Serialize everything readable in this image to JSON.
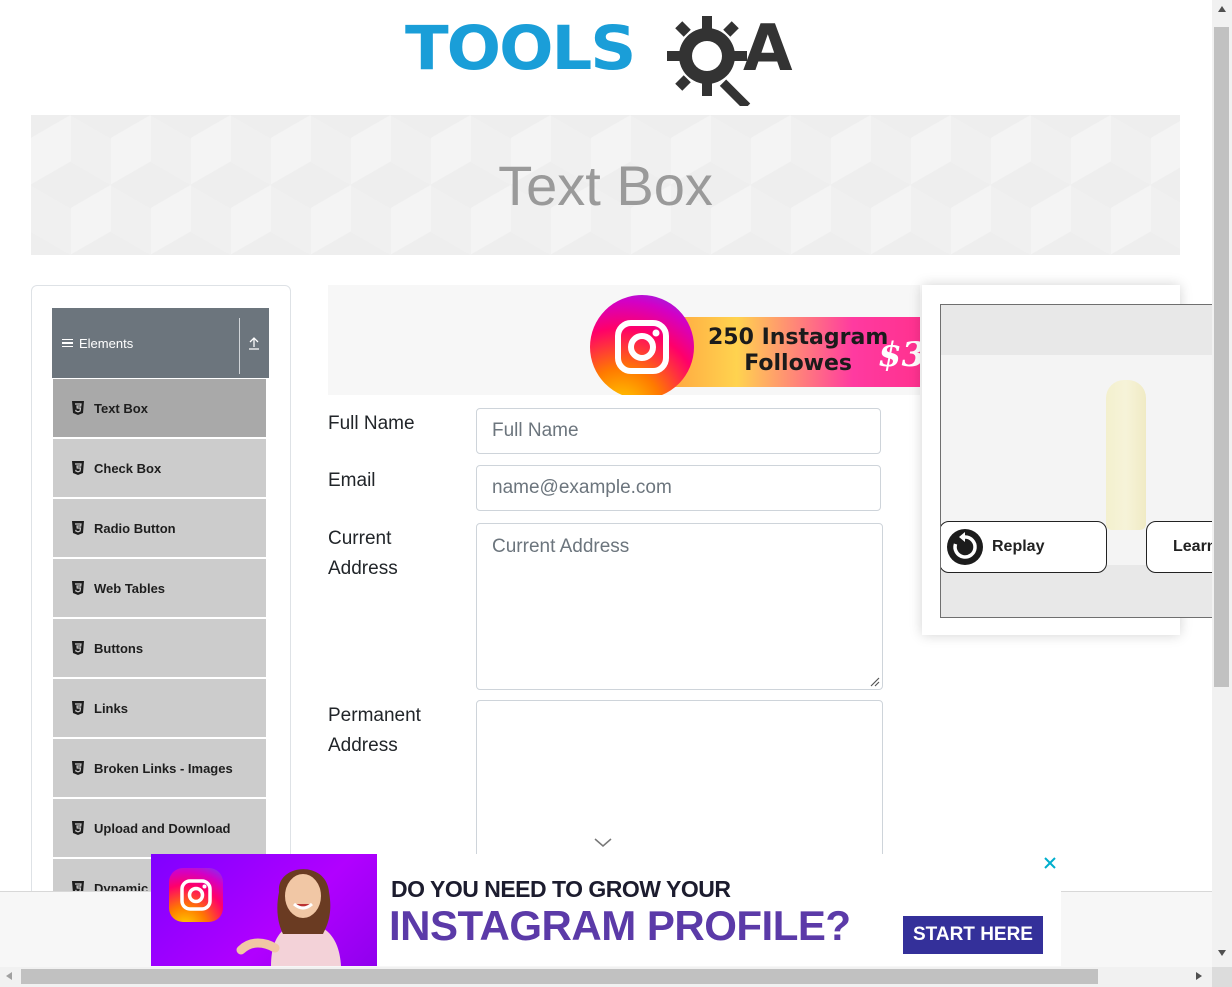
{
  "logo": {
    "tools": "TOOLS",
    "qa": "A"
  },
  "banner": {
    "title": "Text Box"
  },
  "sidebar": {
    "group_title": "Elements",
    "items": [
      {
        "label": "Text Box",
        "active": true
      },
      {
        "label": "Check Box"
      },
      {
        "label": "Radio Button"
      },
      {
        "label": "Web Tables"
      },
      {
        "label": "Buttons"
      },
      {
        "label": "Links"
      },
      {
        "label": "Broken Links - Images"
      },
      {
        "label": "Upload and Download"
      },
      {
        "label": "Dynamic P"
      }
    ]
  },
  "ad_top": {
    "line1": "250 Instagram",
    "line2": "Followes",
    "price": "$3"
  },
  "form": {
    "full_name": {
      "label": "Full Name",
      "placeholder": "Full Name"
    },
    "email": {
      "label": "Email",
      "placeholder": "name@example.com"
    },
    "current_address": {
      "label_line1": "Current",
      "label_line2": "Address",
      "placeholder": "Current Address"
    },
    "permanent_address": {
      "label_line1": "Permanent",
      "label_line2": "Address"
    }
  },
  "video_ad": {
    "replay": "Replay",
    "learn": "Learn"
  },
  "bottom_ad": {
    "line1": "DO YOU NEED TO GROW YOUR",
    "line2": "INSTAGRAM PROFILE?",
    "cta": "START HERE"
  },
  "colors": {
    "brand_blue": "#1a9ed8",
    "sidebar_header": "#6c757d",
    "menu_bg": "#cccccc",
    "menu_active": "#a9a9a9",
    "cta_purple": "#34309a"
  }
}
